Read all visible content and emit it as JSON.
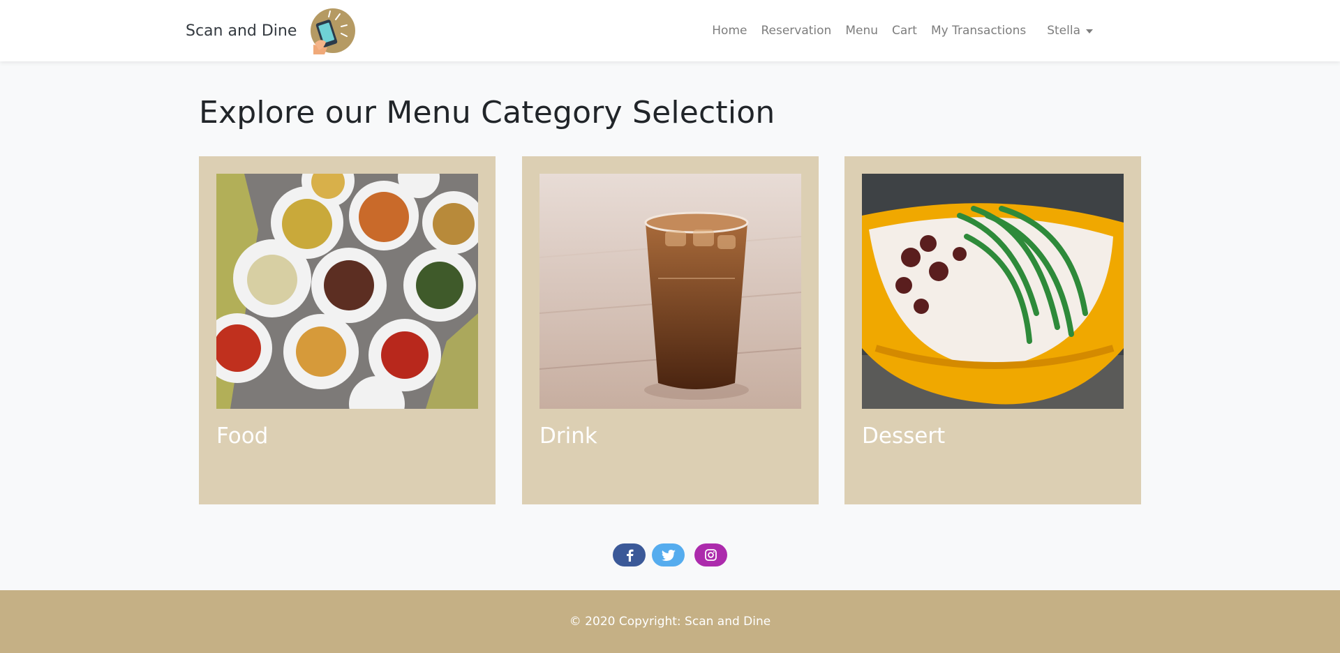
{
  "navbar": {
    "brand_text": "Scan and Dine",
    "logo_icon": "phone-hand-logo-icon",
    "links": [
      "Home",
      "Reservation",
      "Menu",
      "Cart",
      "My Transactions"
    ],
    "user": "Stella"
  },
  "main": {
    "title": "Explore our Menu Category Selection",
    "categories": [
      {
        "label": "Food",
        "image": "food-dishes-image"
      },
      {
        "label": "Drink",
        "image": "iced-tea-glass-image"
      },
      {
        "label": "Dessert",
        "image": "cendol-dessert-bowl-image"
      }
    ]
  },
  "social": [
    {
      "name": "facebook",
      "icon": "facebook-icon",
      "color": "#3b5998"
    },
    {
      "name": "twitter",
      "icon": "twitter-icon",
      "color": "#55acee"
    },
    {
      "name": "instagram",
      "icon": "instagram-icon",
      "color": "#ac2bac"
    }
  ],
  "footer": {
    "copyright": "© 2020 Copyright: Scan and Dine"
  },
  "colors": {
    "card_bg": "#dccfb3",
    "footer_bg": "#c5b085",
    "page_bg": "#f8f9fa"
  }
}
